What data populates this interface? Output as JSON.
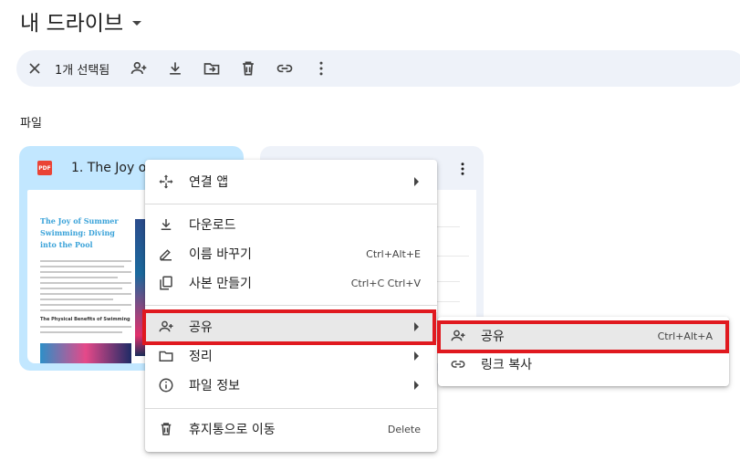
{
  "header": {
    "title": "내 드라이브"
  },
  "toolbar": {
    "selected_count": "1개 선택됨",
    "icons": [
      "close-icon",
      "share-icon",
      "download-icon",
      "move-icon",
      "trash-icon",
      "link-icon",
      "more-icon"
    ]
  },
  "section": {
    "files_label": "파일"
  },
  "files": [
    {
      "name": "1. The Joy of",
      "type_badge": "PDF",
      "thumb": {
        "title": "The Joy of Summer Swimming: Diving into the Pool",
        "subheading": "The Physical Benefits of Swimming"
      }
    },
    {
      "name": ""
    }
  ],
  "context_menu": {
    "items": [
      {
        "label": "연결 앱",
        "shortcut": "",
        "icon": "open-with-icon",
        "submenu": true
      },
      {
        "label": "다운로드",
        "shortcut": "",
        "icon": "download-icon",
        "submenu": false
      },
      {
        "label": "이름 바꾸기",
        "shortcut": "Ctrl+Alt+E",
        "icon": "rename-icon",
        "submenu": false
      },
      {
        "label": "사본 만들기",
        "shortcut": "Ctrl+C Ctrl+V",
        "icon": "copy-icon",
        "submenu": false
      },
      {
        "label": "공유",
        "shortcut": "",
        "icon": "share-icon",
        "submenu": true
      },
      {
        "label": "정리",
        "shortcut": "",
        "icon": "folder-icon",
        "submenu": true
      },
      {
        "label": "파일 정보",
        "shortcut": "",
        "icon": "info-icon",
        "submenu": true
      },
      {
        "label": "휴지통으로 이동",
        "shortcut": "Delete",
        "icon": "trash-icon",
        "submenu": false
      }
    ]
  },
  "share_submenu": {
    "items": [
      {
        "label": "공유",
        "shortcut": "Ctrl+Alt+A",
        "icon": "share-icon"
      },
      {
        "label": "링크 복사",
        "shortcut": "",
        "icon": "link-icon"
      }
    ]
  },
  "colors": {
    "accent_highlight": "#e0191f",
    "card_selected": "#c2e7ff",
    "toolbar_bg": "#eef2f9",
    "pdf_red": "#ea4335"
  }
}
